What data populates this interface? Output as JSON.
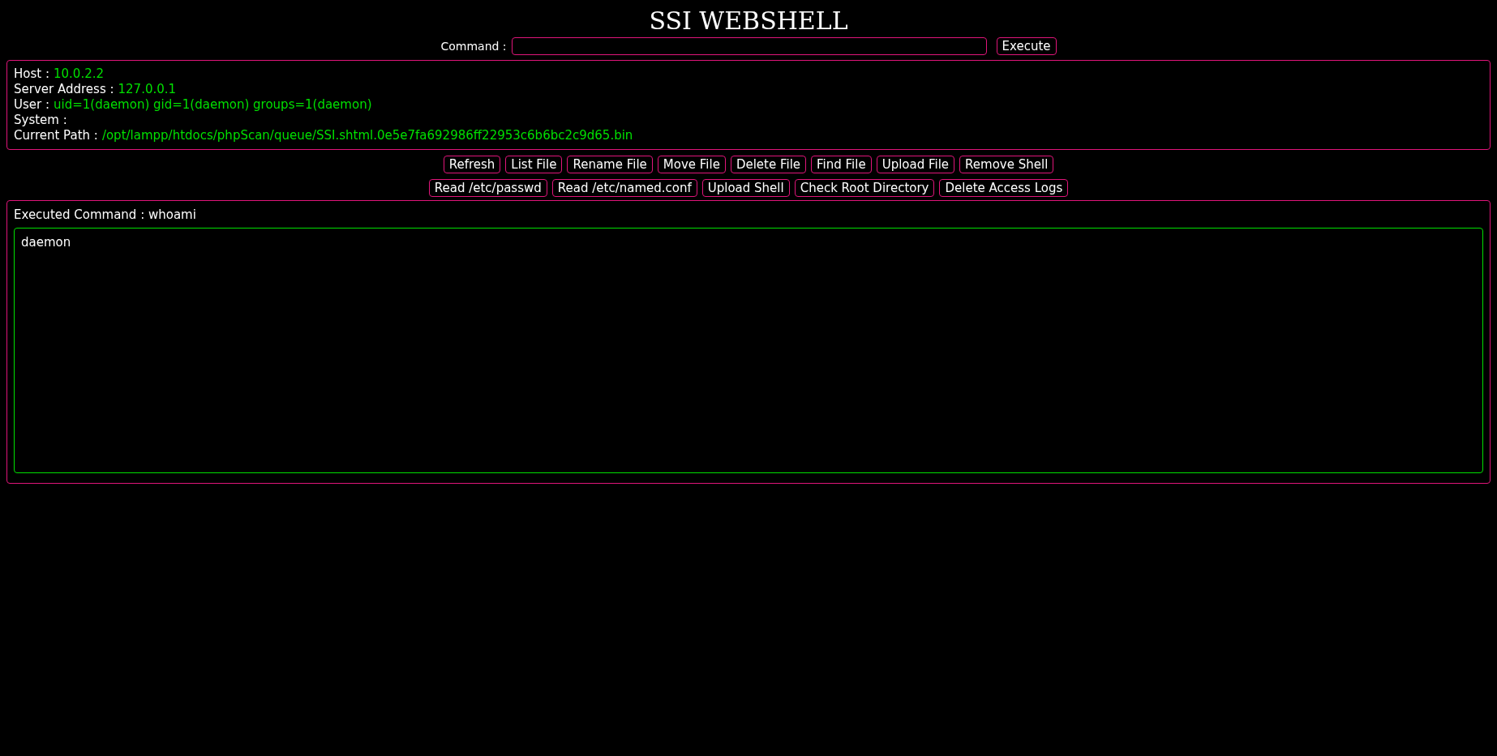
{
  "title": "SSI WEBSHELL",
  "command": {
    "label": "Command :",
    "button": "Execute"
  },
  "info": [
    {
      "label": "Host :",
      "value": "10.0.2.2"
    },
    {
      "label": "Server Address :",
      "value": "127.0.0.1"
    },
    {
      "label": "User :",
      "value": "uid=1(daemon) gid=1(daemon) groups=1(daemon)"
    },
    {
      "label": "System :"
    },
    {
      "label": "Current Path :",
      "value": "/opt/lampp/htdocs/phpScan/queue/SSI.shtml.0e5e7fa692986ff22953c6b6bc2c9d65.bin"
    }
  ],
  "action_rows": [
    [
      "Refresh",
      "List File",
      "Rename File",
      "Move File",
      "Delete File",
      "Find File",
      "Upload File",
      "Remove Shell"
    ],
    [
      "Read /etc/passwd",
      "Read /etc/named.conf",
      "Upload Shell",
      "Check Root Directory",
      "Delete Access Logs"
    ]
  ],
  "output": {
    "label": "Executed Command : whoami",
    "text": "daemon"
  }
}
